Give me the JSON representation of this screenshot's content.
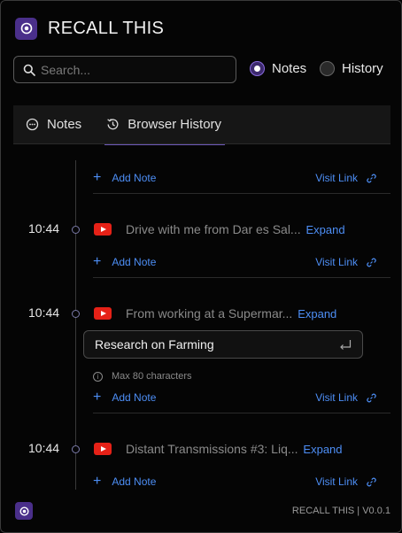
{
  "app": {
    "title": "RECALL THIS"
  },
  "search": {
    "placeholder": "Search..."
  },
  "mode": {
    "notes_label": "Notes",
    "history_label": "History",
    "selected": "Notes"
  },
  "tabs": [
    {
      "label": "Notes",
      "icon": "chat-bubble-icon"
    },
    {
      "label": "Browser History",
      "icon": "history-clock-icon"
    }
  ],
  "links": {
    "add_note": "Add Note",
    "visit_link": "Visit Link",
    "expand": "Expand"
  },
  "entries": [
    {
      "time": "10:44",
      "title": "Drive with me from Dar es Sal...",
      "source": "youtube"
    },
    {
      "time": "10:44",
      "title": "From working at a Supermar...",
      "source": "youtube",
      "note": "Research on Farming"
    },
    {
      "time": "10:44",
      "title": "Distant Transmissions #3: Liq...",
      "source": "youtube"
    }
  ],
  "note_hint": "Max 80 characters",
  "footer": {
    "version": "RECALL THIS | V0.0.1"
  },
  "colors": {
    "accent": "#4d8ef5",
    "brand": "#4a2f8a",
    "youtube": "#e62117"
  }
}
